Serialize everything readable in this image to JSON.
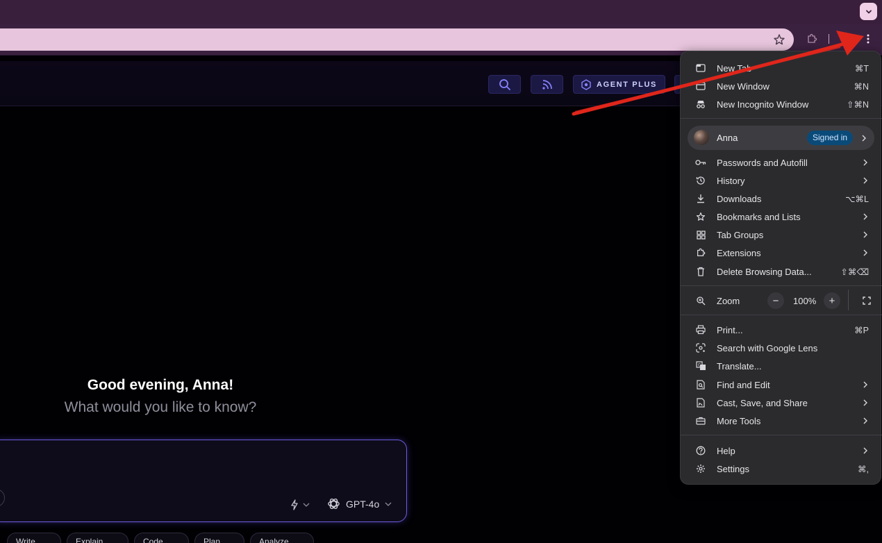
{
  "app": {
    "greeting": "Good evening, Anna!",
    "subtitle": "What would you like to know?",
    "header": {
      "agent_plus_label": "AGENT PLUS"
    },
    "prompt": {
      "model_label": "GPT-4o"
    },
    "chips": [
      "Write",
      "Explain",
      "Code",
      "Plan",
      "Analyze"
    ]
  },
  "menu": {
    "group1": [
      {
        "label": "New Tab",
        "shortcut": "⌘T",
        "icon": "new-tab-icon"
      },
      {
        "label": "New Window",
        "shortcut": "⌘N",
        "icon": "new-window-icon"
      },
      {
        "label": "New Incognito Window",
        "shortcut": "⇧⌘N",
        "icon": "incognito-icon"
      }
    ],
    "profile": {
      "name": "Anna",
      "status": "Signed in"
    },
    "group2": [
      {
        "label": "Passwords and Autofill",
        "icon": "key-icon"
      },
      {
        "label": "History",
        "icon": "history-icon"
      },
      {
        "label": "Downloads",
        "shortcut": "⌥⌘L",
        "icon": "download-icon"
      },
      {
        "label": "Bookmarks and Lists",
        "icon": "star-icon"
      },
      {
        "label": "Tab Groups",
        "icon": "tab-groups-icon"
      },
      {
        "label": "Extensions",
        "icon": "extension-icon"
      },
      {
        "label": "Delete Browsing Data...",
        "shortcut": "⇧⌘⌫",
        "icon": "trash-icon"
      }
    ],
    "zoom": {
      "label": "Zoom",
      "value": "100%",
      "minus": "−",
      "plus": "+"
    },
    "group3": [
      {
        "label": "Print...",
        "shortcut": "⌘P",
        "icon": "print-icon"
      },
      {
        "label": "Search with Google Lens",
        "icon": "lens-icon"
      },
      {
        "label": "Translate...",
        "icon": "translate-icon"
      },
      {
        "label": "Find and Edit",
        "icon": "find-icon"
      },
      {
        "label": "Cast, Save, and Share",
        "icon": "cast-icon"
      },
      {
        "label": "More Tools",
        "icon": "toolbox-icon"
      }
    ],
    "group4": [
      {
        "label": "Help",
        "icon": "help-icon"
      },
      {
        "label": "Settings",
        "shortcut": "⌘,",
        "icon": "gear-icon"
      }
    ]
  },
  "colors": {
    "accent": "#6c5ce0",
    "tabstrip": "#3a1f3c",
    "omnibox": "#e7c5dc",
    "menu_bg": "#2b2b2e",
    "signed_in_badge": "#0a4a78",
    "annotation_arrow": "#e0261b"
  }
}
